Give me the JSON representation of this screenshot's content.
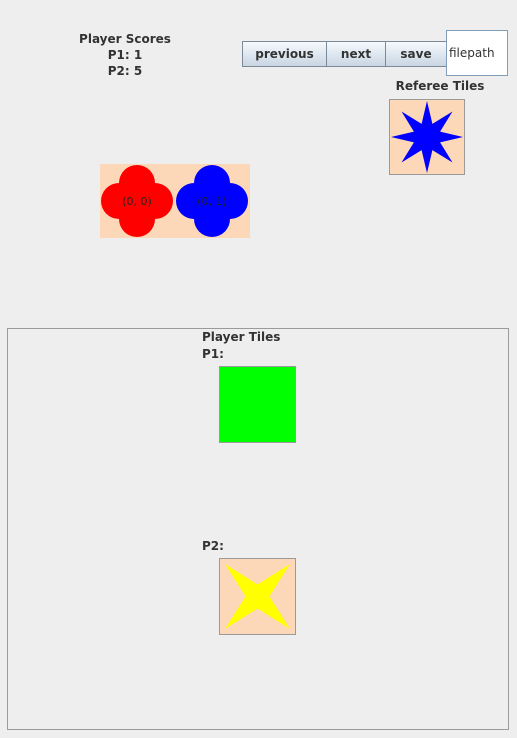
{
  "scores": {
    "title": "Player Scores",
    "lines": [
      "P1: 1",
      "P2: 5"
    ]
  },
  "toolbar": {
    "previous": "previous",
    "next": "next",
    "save": "save",
    "filepath_value": "filepath"
  },
  "referee": {
    "title": "Referee Tiles",
    "tile": {
      "shape": "star-8",
      "color": "#0000ff",
      "background": "#fcd8b8"
    }
  },
  "board": {
    "background": "#fcd8b8",
    "tiles": [
      {
        "label": "(0, 0)",
        "shape": "clover",
        "color": "#ff0000"
      },
      {
        "label": "(0, 1)",
        "shape": "clover",
        "color": "#0000ff"
      }
    ]
  },
  "player_tiles": {
    "title": "Player Tiles",
    "players": [
      {
        "label": "P1:",
        "tile": {
          "shape": "square",
          "color": "#00ff00"
        }
      },
      {
        "label": "P2:",
        "tile": {
          "shape": "star-4",
          "color": "#ffff00",
          "background": "#fcd8b8"
        }
      }
    ]
  }
}
